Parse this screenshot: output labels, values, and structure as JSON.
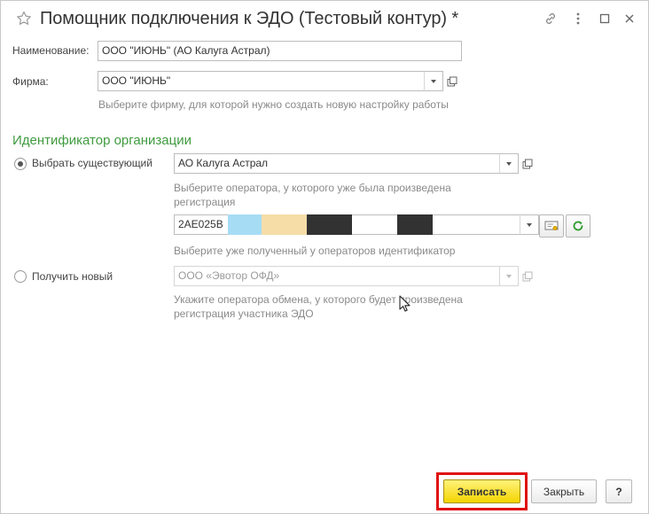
{
  "window": {
    "title": "Помощник подключения к ЭДО (Тестовый контур) *"
  },
  "form": {
    "name_label": "Наименование:",
    "name_value": "ООО \"ИЮНЬ\" (АО Калуга Астрал)",
    "firm_label": "Фирма:",
    "firm_value": "ООО \"ИЮНЬ\"",
    "firm_hint": "Выберите фирму, для которой нужно создать новую настройку работы"
  },
  "identifier": {
    "section_title": "Идентификатор организации",
    "existing": {
      "label": "Выбрать существующий",
      "selected": true,
      "operator_value": "АО Калуга Астрал",
      "operator_hint": "Выберите оператора, у которого уже была произведена регистрация",
      "id_value": "2AE025B",
      "id_hint": "Выберите уже полученный у операторов идентификатор"
    },
    "new": {
      "label": "Получить новый",
      "selected": false,
      "operator_placeholder": "ООО «Эвотор ОФД»",
      "operator_hint": "Укажите оператора обмена, у которого будет произведена регистрация участника ЭДО"
    }
  },
  "footer": {
    "save_label": "Записать",
    "close_label": "Закрыть",
    "help_label": "?"
  },
  "colors": {
    "section": "#3f9b3f",
    "primary_button": "#f4d400",
    "highlight_frame": "#e01010"
  },
  "icons": {
    "favorite": "star-icon",
    "link": "link-icon",
    "more": "more-icon",
    "maximize": "maximize-icon",
    "close": "close-icon",
    "open": "open-icon",
    "dropdown": "chevron-down-icon",
    "certificate": "certificate-icon",
    "refresh": "refresh-icon"
  }
}
